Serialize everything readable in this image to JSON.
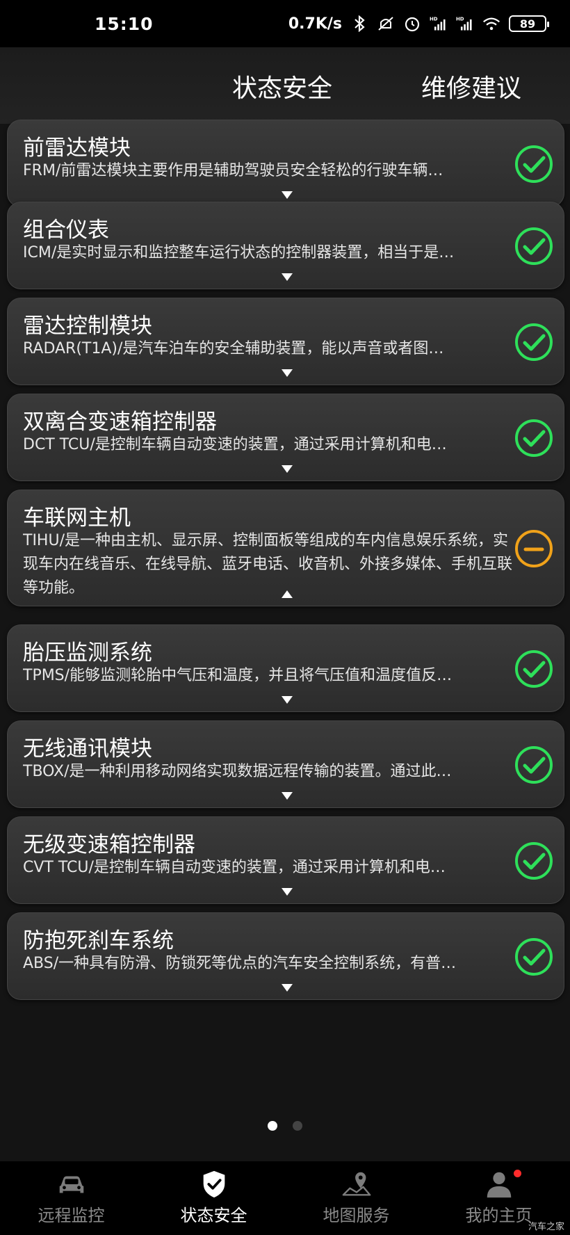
{
  "status_bar": {
    "time": "15:10",
    "speed": "0.7K/s",
    "battery": "89",
    "icons": [
      "bluetooth-icon",
      "mute-icon",
      "alarm-icon",
      "signal-hd-icon",
      "signal-hd-icon",
      "wifi-icon",
      "battery-icon"
    ]
  },
  "header": {
    "tab_status": "状态安全",
    "tab_repair": "维修建议"
  },
  "colors": {
    "ok": "#2ee05a",
    "warn": "#f0a21a"
  },
  "cards": [
    {
      "title": "前雷达模块",
      "desc": "FRM/前雷达模块主要作用是辅助驾驶员安全轻松的行驶车辆…",
      "status": "ok",
      "expanded": false
    },
    {
      "title": "组合仪表",
      "desc": "ICM/是实时显示和监控整车运行状态的控制器装置，相当于是…",
      "status": "ok",
      "expanded": false
    },
    {
      "title": "雷达控制模块",
      "desc": "RADAR(T1A)/是汽车泊车的安全辅助装置，能以声音或者图…",
      "status": "ok",
      "expanded": false
    },
    {
      "title": "双离合变速箱控制器",
      "desc": "DCT TCU/是控制车辆自动变速的装置，通过采用计算机和电…",
      "status": "ok",
      "expanded": false
    },
    {
      "title": "车联网主机",
      "desc": "TIHU/是一种由主机、显示屏、控制面板等组成的车内信息娱乐系统，实现车内在线音乐、在线导航、蓝牙电话、收音机、外接多媒体、手机互联等功能。",
      "status": "warn",
      "expanded": true
    },
    {
      "title": "胎压监测系统",
      "desc": "TPMS/能够监测轮胎中气压和温度，并且将气压值和温度值反…",
      "status": "ok",
      "expanded": false
    },
    {
      "title": "无线通讯模块",
      "desc": "TBOX/是一种利用移动网络实现数据远程传输的装置。通过此…",
      "status": "ok",
      "expanded": false
    },
    {
      "title": "无级变速箱控制器",
      "desc": "CVT TCU/是控制车辆自动变速的装置，通过采用计算机和电…",
      "status": "ok",
      "expanded": false
    },
    {
      "title": "防抱死刹车系统",
      "desc": "ABS/一种具有防滑、防锁死等优点的汽车安全控制系统，有普…",
      "status": "ok",
      "expanded": false
    }
  ],
  "pager": {
    "pages": 2,
    "current": 1
  },
  "bottom_nav": [
    {
      "label": "远程监控",
      "icon": "car-icon",
      "active": false
    },
    {
      "label": "状态安全",
      "icon": "shield-check-icon",
      "active": true
    },
    {
      "label": "地图服务",
      "icon": "map-pin-icon",
      "active": false
    },
    {
      "label": "我的主页",
      "icon": "user-icon",
      "active": false,
      "badge": true
    }
  ],
  "watermark": "汽车之家"
}
